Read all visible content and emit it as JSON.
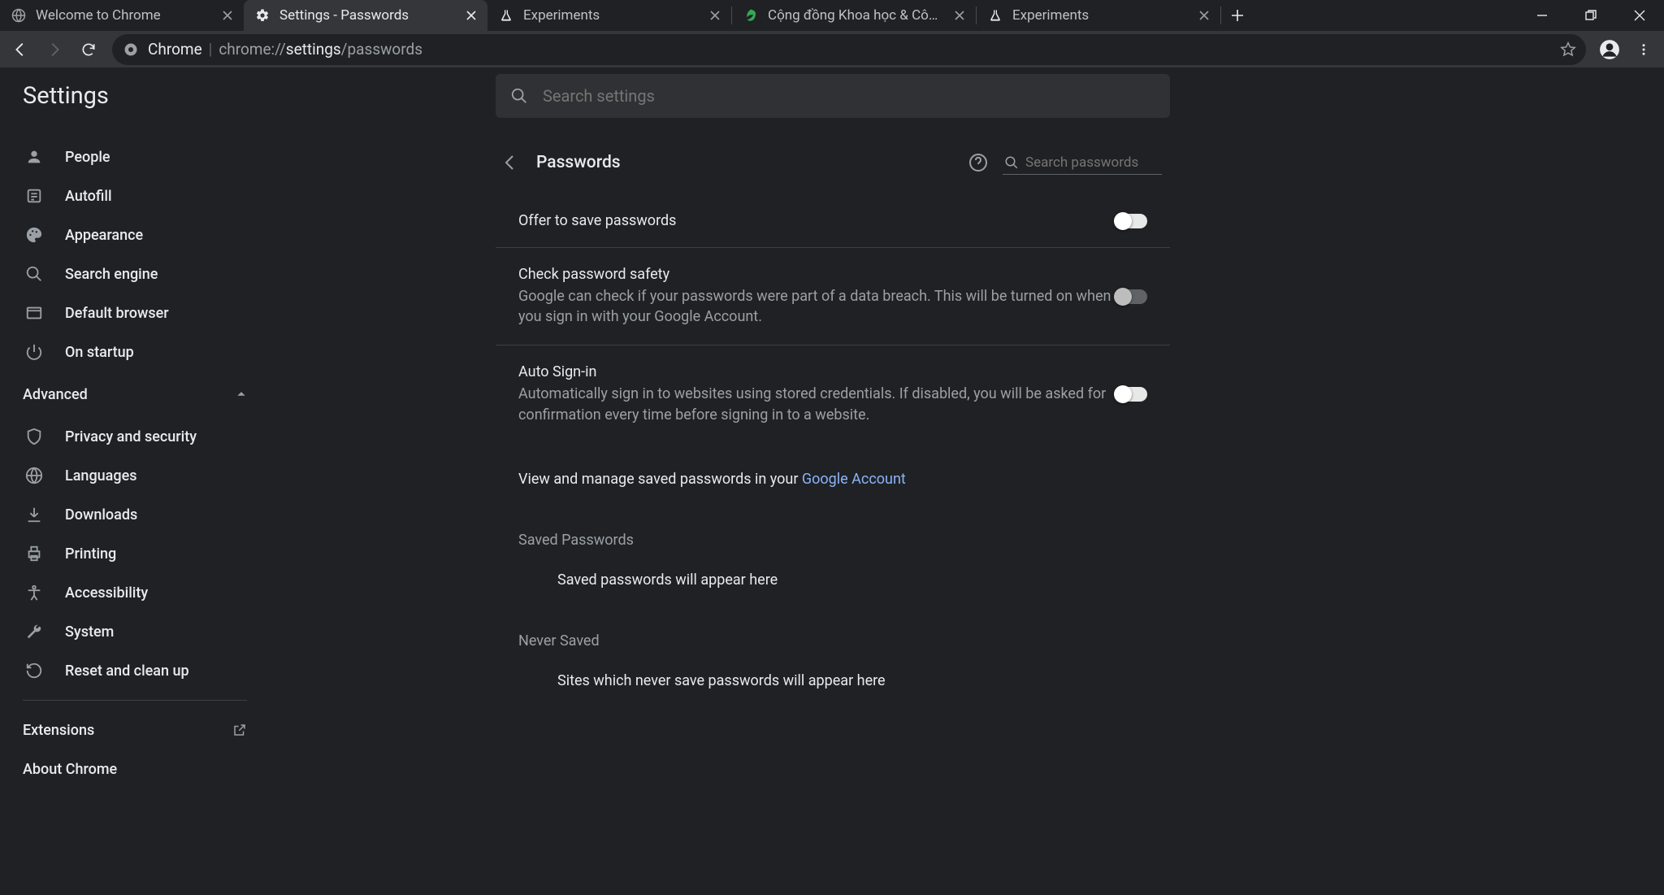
{
  "tabs": [
    {
      "title": "Welcome to Chrome",
      "icon": "globe"
    },
    {
      "title": "Settings - Passwords",
      "icon": "gear",
      "active": true
    },
    {
      "title": "Experiments",
      "icon": "flask"
    },
    {
      "title": "Cộng đồng Khoa học & Công ng",
      "icon": "leaf"
    },
    {
      "title": "Experiments",
      "icon": "flask"
    }
  ],
  "omnibox": {
    "origin": "Chrome",
    "url_prefix": "chrome://",
    "url_mid": "settings",
    "url_suffix": "/passwords"
  },
  "settings": {
    "title": "Settings",
    "search_placeholder": "Search settings"
  },
  "sidebar": {
    "items": [
      {
        "label": "People"
      },
      {
        "label": "Autofill"
      },
      {
        "label": "Appearance"
      },
      {
        "label": "Search engine"
      },
      {
        "label": "Default browser"
      },
      {
        "label": "On startup"
      }
    ],
    "advanced_label": "Advanced",
    "advanced_items": [
      {
        "label": "Privacy and security"
      },
      {
        "label": "Languages"
      },
      {
        "label": "Downloads"
      },
      {
        "label": "Printing"
      },
      {
        "label": "Accessibility"
      },
      {
        "label": "System"
      },
      {
        "label": "Reset and clean up"
      }
    ],
    "extensions_label": "Extensions",
    "about_label": "About Chrome"
  },
  "passwords": {
    "header": "Passwords",
    "search_placeholder": "Search passwords",
    "offer": {
      "title": "Offer to save passwords"
    },
    "check": {
      "title": "Check password safety",
      "desc": "Google can check if your passwords were part of a data breach. This will be turned on when you sign in with your Google Account."
    },
    "autosignin": {
      "title": "Auto Sign-in",
      "desc": "Automatically sign in to websites using stored credentials. If disabled, you will be asked for confirmation every time before signing in to a website."
    },
    "manage_text": "View and manage saved passwords in your ",
    "manage_link": "Google Account",
    "saved_label": "Saved Passwords",
    "saved_empty": "Saved passwords will appear here",
    "never_label": "Never Saved",
    "never_empty": "Sites which never save passwords will appear here"
  }
}
